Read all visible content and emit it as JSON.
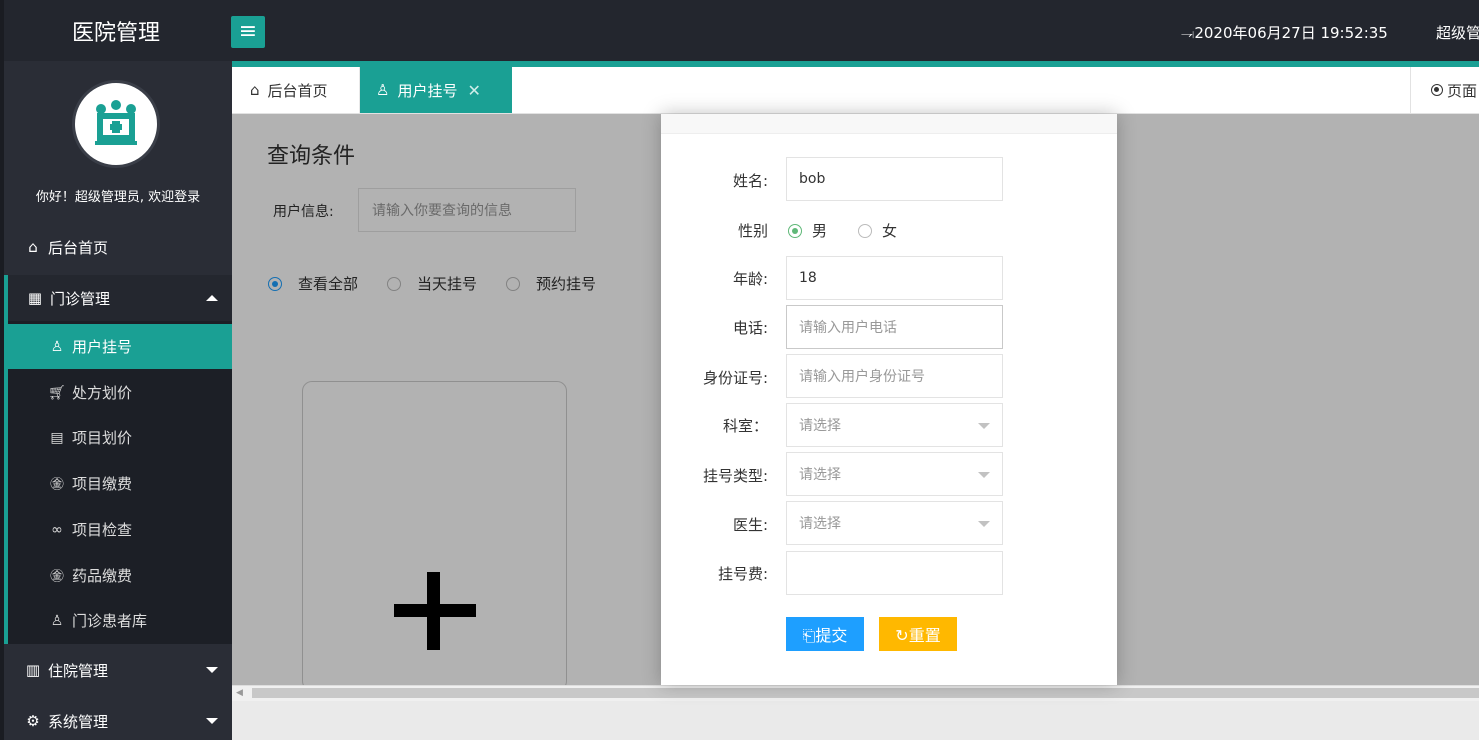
{
  "header": {
    "brand": "医院管理",
    "menu_toggle_icon": "hamburger-icon",
    "datetime": "⥗2020年06月27日 19:52:35",
    "user": "超级管"
  },
  "sidebar": {
    "welcome": "你好！超级管理员, 欢迎登录",
    "home": "后台首页",
    "clinic": "门诊管理",
    "clinic_items": [
      {
        "label": "用户挂号",
        "icon": "user-icon"
      },
      {
        "label": "处方划价",
        "icon": "cart-icon"
      },
      {
        "label": "项目划价",
        "icon": "document-icon"
      },
      {
        "label": "项目缴费",
        "icon": "yen-icon"
      },
      {
        "label": "项目检查",
        "icon": "infinity-icon"
      },
      {
        "label": "药品缴费",
        "icon": "yen-icon"
      },
      {
        "label": "门诊患者库",
        "icon": "person-icon"
      }
    ],
    "inpatient": "住院管理",
    "system": "系统管理"
  },
  "tabs": [
    {
      "label": "后台首页",
      "icon": "home-icon",
      "active": false
    },
    {
      "label": "用户挂号",
      "icon": "user-icon",
      "active": true
    }
  ],
  "page_ops": "页面",
  "main": {
    "query_title": "查询条件",
    "user_info_label": "用户信息:",
    "user_info_placeholder": "请输入你要查询的信息",
    "filters": [
      {
        "label": "查看全部",
        "selected": true
      },
      {
        "label": "当天挂号",
        "selected": false
      },
      {
        "label": "预约挂号",
        "selected": false
      }
    ],
    "add_card_icon": "plus-icon"
  },
  "modal": {
    "fields": {
      "name_label": "姓名:",
      "name_value": "bob",
      "gender_label": "性别",
      "gender_male": "男",
      "gender_female": "女",
      "gender_selected": "男",
      "age_label": "年龄:",
      "age_value": "18",
      "phone_label": "电话:",
      "phone_placeholder": "请输入用户电话",
      "id_label": "身份证号:",
      "id_placeholder": "请输入用户身份证号",
      "dept_label": "科室：",
      "dept_value": "请选择",
      "type_label": "挂号类型:",
      "type_value": "请选择",
      "doctor_label": "医生:",
      "doctor_value": "请选择",
      "fee_label": "挂号费:",
      "fee_value": ""
    },
    "submit": "⎗提交",
    "reset": "↻重置"
  },
  "colors": {
    "header_bg": "#23262e",
    "sidebar_bg": "#2a2d36",
    "accent": "#1aa094",
    "submit": "#1e9fff",
    "reset": "#ffb800"
  }
}
